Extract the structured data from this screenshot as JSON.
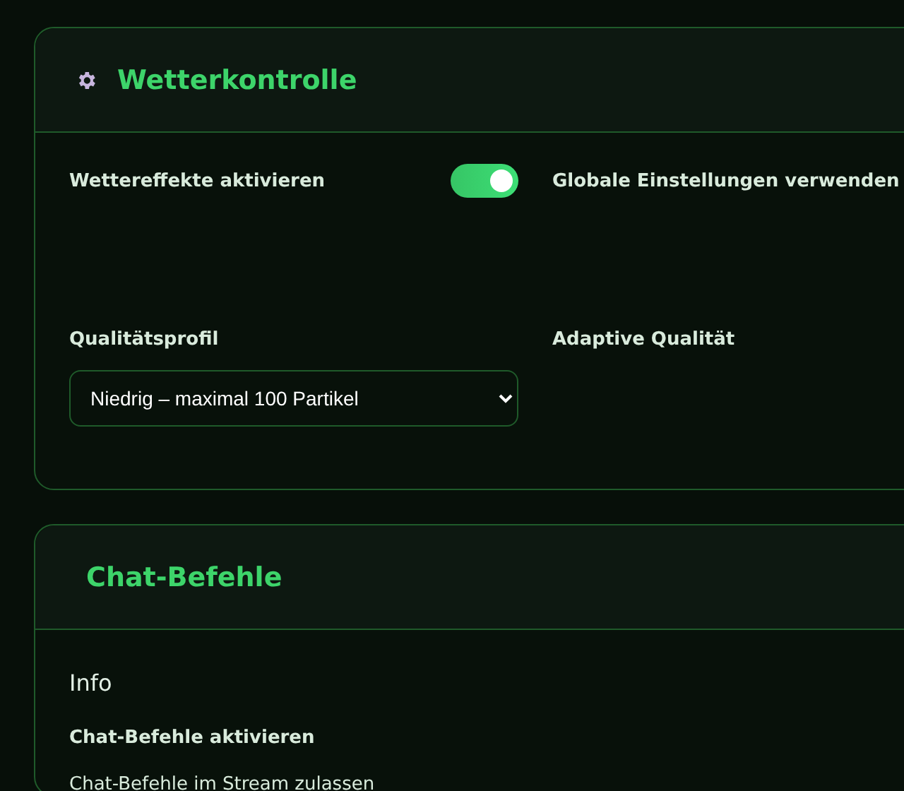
{
  "weather_panel": {
    "title": "Wetterkontrolle",
    "fields": [
      {
        "kind": "toggle",
        "label": "Wettereffekte aktivieren",
        "on": true
      },
      {
        "kind": "label",
        "label": "Globale Einstellungen verwenden"
      },
      {
        "kind": "select",
        "label": "Qualitätsprofil",
        "value": "Niedrig – maximal 100 Partikel"
      },
      {
        "kind": "label",
        "label": "Adaptive Qualität"
      }
    ]
  },
  "chat_panel": {
    "title": "Chat-Befehle",
    "section": "Info",
    "setting_label": "Chat-Befehle aktivieren",
    "setting_description": "Chat-Befehle im Stream zulassen"
  }
}
